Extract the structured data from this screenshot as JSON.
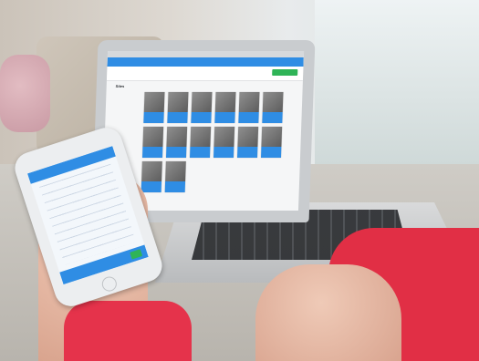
{
  "scene": {
    "description": "",
    "laptop_app": {
      "section_label": "Sites",
      "cards_visible": 14
    },
    "phone_app": {}
  }
}
